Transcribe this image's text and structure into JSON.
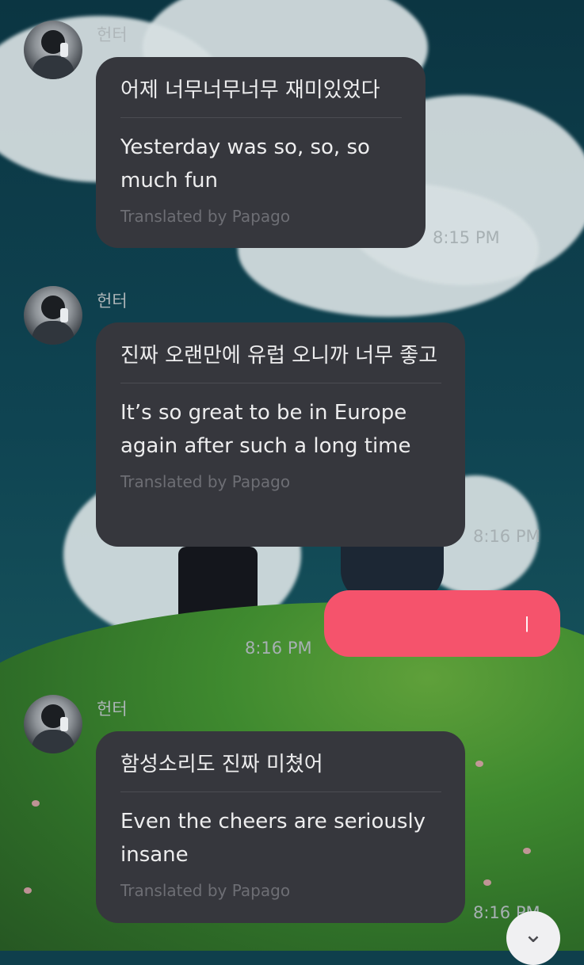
{
  "sender": "헌터",
  "messages": [
    {
      "original": "어제 너무너무너무 재미있었다",
      "translation": "Yesterday was so, so, so much fun",
      "credit": "Translated by Papago",
      "time": "8:15 PM"
    },
    {
      "original": "진짜 오랜만에 유럽 오니까 너무 좋고",
      "translation": "It’s so great to be in Europe again after such a long time",
      "credit": "Translated by Papago",
      "time": "8:16 PM"
    },
    {
      "original": "함성소리도 진짜 미쳤어",
      "translation": "Even the cheers are seriously insane",
      "credit": "Translated by Papago",
      "time": "8:16 PM"
    }
  ],
  "my_message": {
    "text": "ㅣ",
    "time": "8:16 PM"
  },
  "colors": {
    "my_bubble": "#f5536c",
    "their_bubble": "#36373d"
  },
  "scroll_button": {
    "icon": "chevron-down-icon"
  }
}
